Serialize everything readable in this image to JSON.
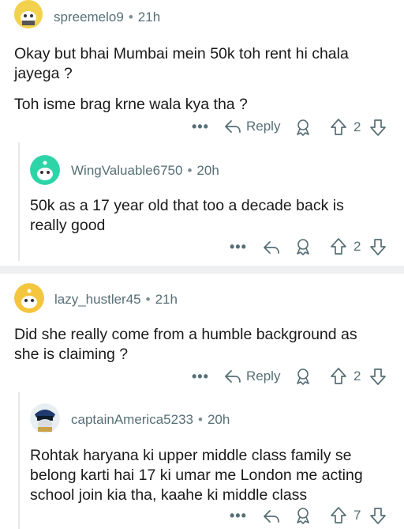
{
  "comments": [
    {
      "username": "spreemelo9",
      "time": "21h",
      "lines": [
        "Okay but bhai Mumbai mein 50k toh rent hi chala",
        "jayega ?",
        "",
        "Toh isme brag krne wala kya tha ?"
      ],
      "reply_label": "Reply",
      "votes": "2"
    },
    {
      "username": "WingValuable6750",
      "time": "20h",
      "lines": [
        "50k as a 17 year old that too a decade back is",
        "really good"
      ],
      "votes": "2"
    },
    {
      "username": "lazy_hustler45",
      "time": "21h",
      "lines": [
        "Did she really come from a humble background as",
        "she is claiming ?"
      ],
      "reply_label": "Reply",
      "votes": "2"
    },
    {
      "username": "captainAmerica5233",
      "time": "20h",
      "lines": [
        "Rohtak haryana ki upper middle class family se",
        "belong karti hai 17 ki umar me London me acting",
        "school join kia tha, kaahe ki middle class"
      ],
      "votes": "7"
    }
  ],
  "more_label": "•••",
  "separator_dot": "•",
  "colors": {
    "meta": "#576f76",
    "separator": "#eeeff1",
    "thread": "#e6e8ea",
    "wing_avatar": "#2dd4a8",
    "lazy_avatar": "#f4c63d"
  }
}
